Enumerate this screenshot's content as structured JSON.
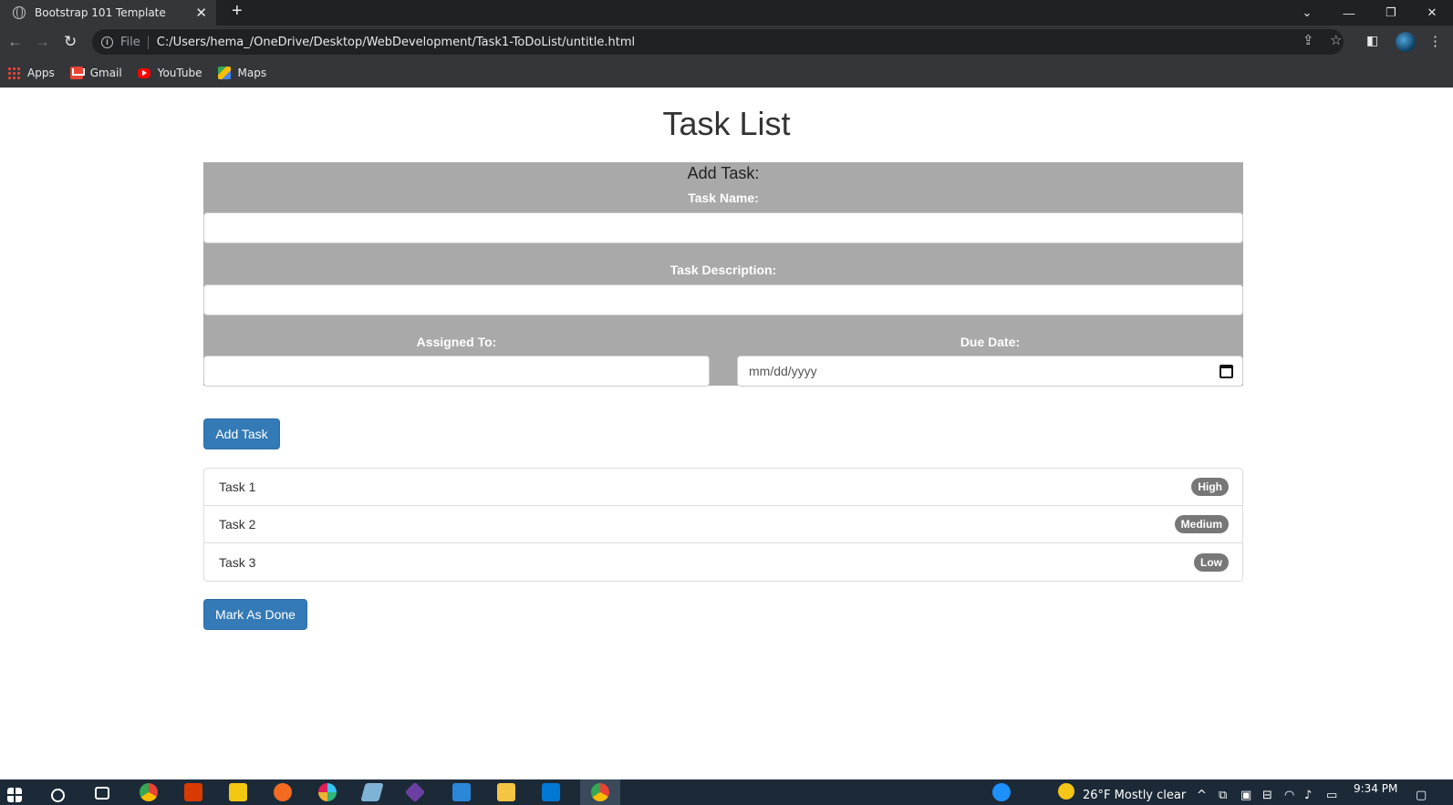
{
  "browser": {
    "tab_title": "Bootstrap 101 Template",
    "address_scheme": "File",
    "address_url": "C:/Users/hema_/OneDrive/Desktop/WebDevelopment/Task1-ToDoList/untitle.html",
    "bookmarks": [
      {
        "label": "Apps",
        "icon": "apps-grid-icon"
      },
      {
        "label": "Gmail",
        "icon": "gmail-icon"
      },
      {
        "label": "YouTube",
        "icon": "youtube-icon"
      },
      {
        "label": "Maps",
        "icon": "maps-icon"
      }
    ]
  },
  "page": {
    "title": "Task List",
    "form": {
      "heading": "Add Task:",
      "task_name_label": "Task Name:",
      "task_description_label": "Task Description:",
      "assigned_to_label": "Assigned To:",
      "due_date_label": "Due Date:",
      "due_date_placeholder": "mm/dd/yyyy"
    },
    "add_button": "Add Task",
    "tasks": [
      {
        "name": "Task 1",
        "priority": "High"
      },
      {
        "name": "Task 2",
        "priority": "Medium"
      },
      {
        "name": "Task 3",
        "priority": "Low"
      }
    ],
    "done_button": "Mark As Done"
  },
  "taskbar": {
    "weather": "26°F  Mostly clear",
    "time": "9:34 PM"
  },
  "colors": {
    "panel_bg": "#a9a9a9",
    "primary": "#337ab7",
    "badge": "#777777"
  }
}
